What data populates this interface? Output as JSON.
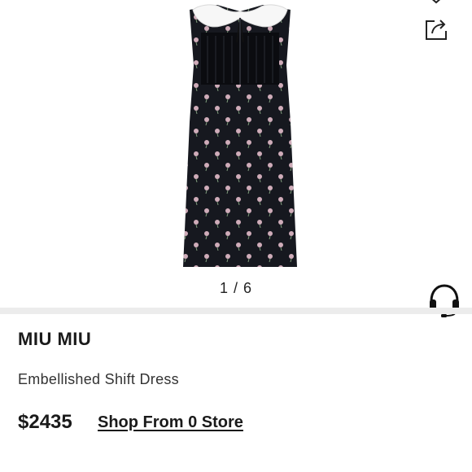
{
  "gallery": {
    "counter": "1 / 6",
    "current_image": 1,
    "total_images": 6,
    "dress_color": "#16181f",
    "flower_color": "#f0c6d4",
    "collar_color": "#f7f7f7"
  },
  "product": {
    "brand": "MIU MIU",
    "name": "Embellished Shift Dress",
    "price": "$2435",
    "shop_link": "Shop From 0 Store"
  },
  "icons": {
    "top": "chevron-icon",
    "share": "share-icon",
    "support": "headset-icon"
  },
  "colors": {
    "text": "#1a1a1a",
    "divider": "#ececec",
    "background": "#ffffff"
  }
}
